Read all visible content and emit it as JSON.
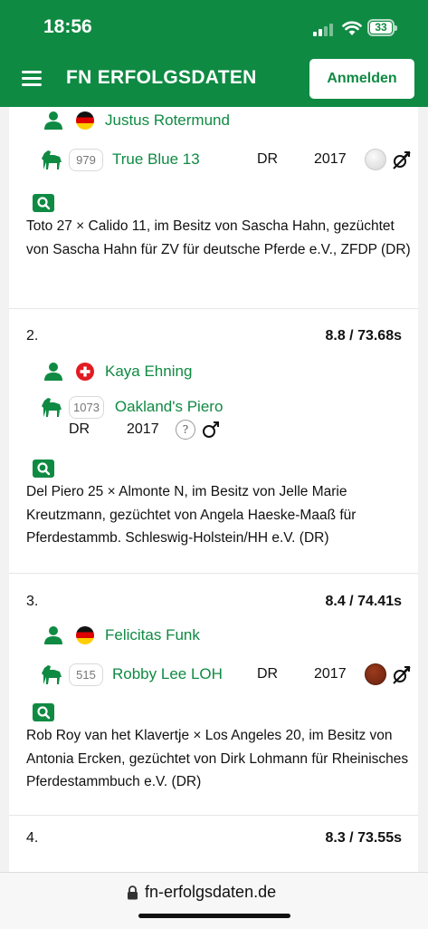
{
  "status_bar": {
    "time": "18:56",
    "battery": "33"
  },
  "header": {
    "brand": "FN ERFOLGSDATEN",
    "login_label": "Anmelden"
  },
  "entries": [
    {
      "rider": "Justus Rotermund",
      "horse_number": "979",
      "horse_name": "True Blue 13",
      "breed": "DR",
      "year": "2017",
      "description": "Toto 27 × Calido 11, im Besitz von Sascha Hahn, gezüchtet von Sascha Hahn für ZV für deutsche Pferde e.V., ZFDP (DR)"
    },
    {
      "rank": "2.",
      "score": "8.8 / 73.68s",
      "rider": "Kaya Ehning",
      "horse_number": "1073",
      "horse_name": "Oakland's Piero",
      "breed": "DR",
      "year": "2017",
      "color_unknown": "?",
      "description": "Del Piero 25 × Almonte N, im Besitz von Jelle Marie Kreutzmann, gezüchtet von Angela Haeske-Maaß für Pferdestammb. Schleswig-Holstein/HH e.V. (DR)"
    },
    {
      "rank": "3.",
      "score": "8.4 / 74.41s",
      "rider": "Felicitas Funk",
      "horse_number": "515",
      "horse_name": "Robby Lee LOH",
      "breed": "DR",
      "year": "2017",
      "description": "Rob Roy van het Klavertje × Los Angeles 20, im Besitz von Antonia Ercken, gezüchtet von Dirk Lohmann für Rheinisches Pferdestammbuch e.V. (DR)"
    },
    {
      "rank": "4.",
      "score": "8.3 / 73.55s"
    }
  ],
  "browser": {
    "url": "fn-erfolgsdaten.de"
  },
  "colors": {
    "brand_green": "#0f8a43",
    "grey_coat": "#e6e6e6",
    "chestnut_coat": "#7a2a14"
  },
  "icons": [
    "menu-icon",
    "person-icon",
    "flag-germany-icon",
    "flag-switzerland-icon",
    "horse-icon",
    "search-icon",
    "gelding-icon",
    "stallion-icon",
    "lock-icon"
  ]
}
